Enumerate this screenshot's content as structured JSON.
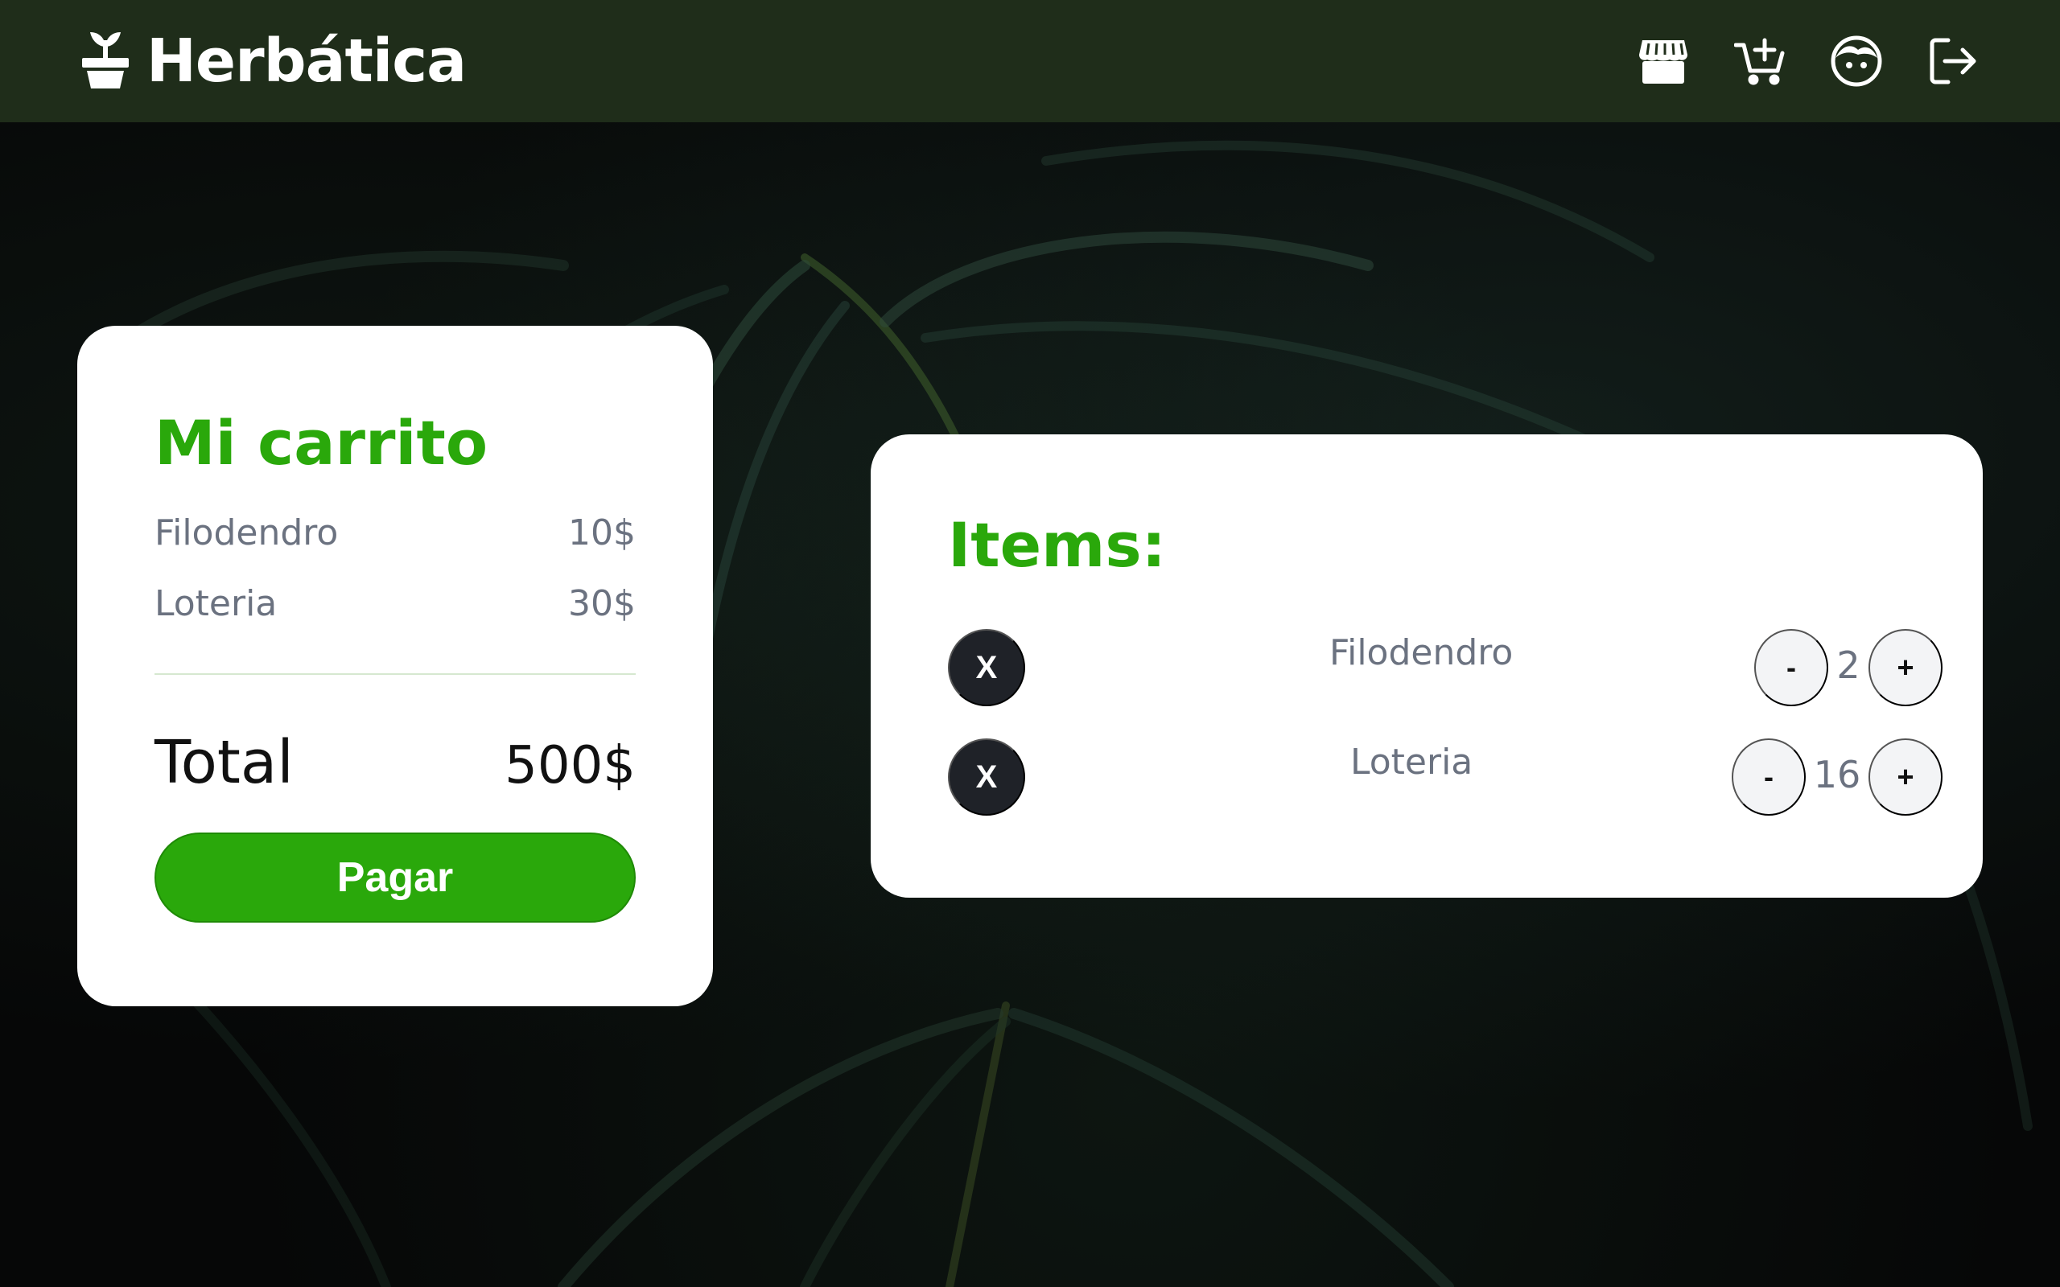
{
  "header": {
    "brand": "Herbática",
    "icons": [
      "plant-pot-icon",
      "store-icon",
      "cart-add-icon",
      "user-face-icon",
      "logout-icon"
    ]
  },
  "cart": {
    "title": "Mi carrito",
    "lines": [
      {
        "name": "Filodendro",
        "price": "10$"
      },
      {
        "name": "Loteria",
        "price": "30$"
      }
    ],
    "total_label": "Total",
    "total_value": "500$",
    "pay_label": "Pagar"
  },
  "items": {
    "title": "Items:",
    "rows": [
      {
        "remove_label": "X",
        "name": "Filodendro",
        "minus": "-",
        "qty": "2",
        "plus": "+"
      },
      {
        "remove_label": "X",
        "name": "Loteria",
        "minus": "-",
        "qty": "16",
        "plus": "+"
      }
    ]
  },
  "colors": {
    "navbar": "#1f2d1a",
    "accent": "#2aa80b",
    "remove_button": "#1f2228"
  }
}
